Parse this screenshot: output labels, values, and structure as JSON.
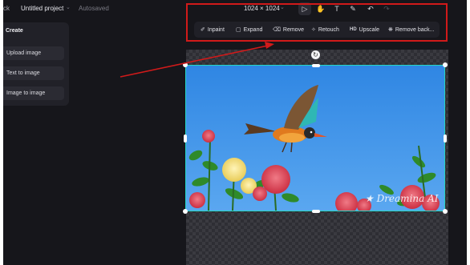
{
  "topbar": {
    "back_label": "ck",
    "project_name": "Untitled project",
    "autosave_status": "Autosaved",
    "canvas_size": "1024 × 1024",
    "tools": [
      {
        "name": "select-pointer",
        "glyph": "▷",
        "active": true
      },
      {
        "name": "hand-pan",
        "glyph": "✋",
        "active": false
      },
      {
        "name": "text-tool",
        "glyph": "T",
        "active": false
      },
      {
        "name": "brush-tool",
        "glyph": "✎",
        "active": false
      },
      {
        "name": "undo",
        "glyph": "↶",
        "active": false
      },
      {
        "name": "redo",
        "glyph": "↷",
        "active": false,
        "disabled": true
      }
    ]
  },
  "edit_toolbar": {
    "items": [
      {
        "label": "Inpaint",
        "icon": "inpaint-brush-icon",
        "glyph": "✐"
      },
      {
        "label": "Expand",
        "icon": "expand-frame-icon",
        "glyph": "▢"
      },
      {
        "label": "Remove",
        "icon": "eraser-icon",
        "glyph": "⌫"
      },
      {
        "label": "Retouch",
        "icon": "magic-wand-icon",
        "glyph": "✧"
      },
      {
        "label": "Upscale",
        "icon": "hd-icon",
        "glyph": "HD"
      },
      {
        "label": "Remove back...",
        "icon": "background-remove-icon",
        "glyph": "❋"
      }
    ]
  },
  "create_panel": {
    "title": "Create",
    "items": [
      "Upload image",
      "Text to image",
      "Image to image"
    ]
  },
  "canvas": {
    "rotate_glyph": "↻",
    "watermark_text": "★ Dreamina AI"
  },
  "colors": {
    "app_background": "#16161b",
    "selection_border": "#24d6c4",
    "annotation_red": "#d11a1a",
    "sky_blue": "#3c8ee6"
  }
}
